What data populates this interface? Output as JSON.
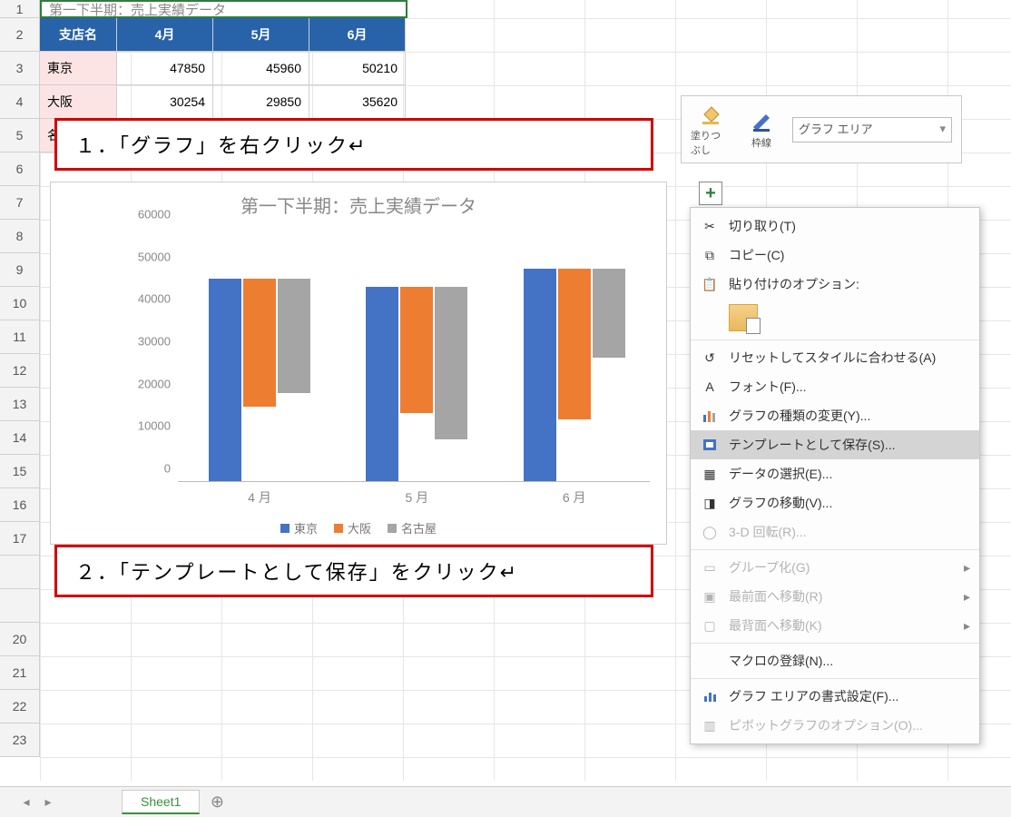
{
  "table": {
    "title_row": "第一下半期：売上実績データ",
    "headers": {
      "name": "支店名",
      "m1": "4月",
      "m2": "5月",
      "m3": "6月"
    },
    "rows": [
      {
        "name": "東京",
        "v1": "47850",
        "v2": "45960",
        "v3": "50210"
      },
      {
        "name": "大阪",
        "v1": "30254",
        "v2": "29850",
        "v3": "35620"
      },
      {
        "name": "名"
      }
    ]
  },
  "row_numbers": [
    "1",
    "2",
    "3",
    "4",
    "5",
    "6",
    "7",
    "8",
    "9",
    "10",
    "11",
    "12",
    "13",
    "14",
    "15",
    "16",
    "17",
    "",
    "",
    "20",
    "21",
    "22",
    "23"
  ],
  "callouts": {
    "c1": "１．「グラフ」を右クリック↵",
    "c2": "２．「テンプレートとして保存」をクリック↵"
  },
  "chart_data": {
    "type": "bar",
    "title": "第一下半期：売上実績データ",
    "categories": [
      "4 月",
      "5 月",
      "6 月"
    ],
    "series": [
      {
        "name": "東京",
        "values": [
          47850,
          45960,
          50210
        ],
        "color": "#4472c4"
      },
      {
        "name": "大阪",
        "values": [
          30254,
          29850,
          35620
        ],
        "color": "#ed7d31"
      },
      {
        "name": "名古屋",
        "values": [
          27000,
          36000,
          21000
        ],
        "color": "#a5a5a5"
      }
    ],
    "ylim": [
      0,
      60000
    ],
    "yticks": [
      0,
      10000,
      20000,
      30000,
      40000,
      50000,
      60000
    ],
    "xlabel": "",
    "ylabel": ""
  },
  "mini_toolbar": {
    "fill": "塗りつぶし",
    "outline": "枠線",
    "area": "グラフ エリア"
  },
  "context_menu": {
    "cut": "切り取り(T)",
    "copy": "コピー(C)",
    "paste_label": "貼り付けのオプション:",
    "reset": "リセットしてスタイルに合わせる(A)",
    "font": "フォント(F)...",
    "change_type": "グラフの種類の変更(Y)...",
    "save_template": "テンプレートとして保存(S)...",
    "select_data": "データの選択(E)...",
    "move_chart": "グラフの移動(V)...",
    "rotate3d": "3-D 回転(R)...",
    "group": "グループ化(G)",
    "bring_front": "最前面へ移動(R)",
    "send_back": "最背面へ移動(K)",
    "assign_macro": "マクロの登録(N)...",
    "format_area": "グラフ エリアの書式設定(F)...",
    "pivot_opts": "ピボットグラフのオプション(O)..."
  },
  "sheet_tabs": {
    "tab1": "Sheet1"
  }
}
